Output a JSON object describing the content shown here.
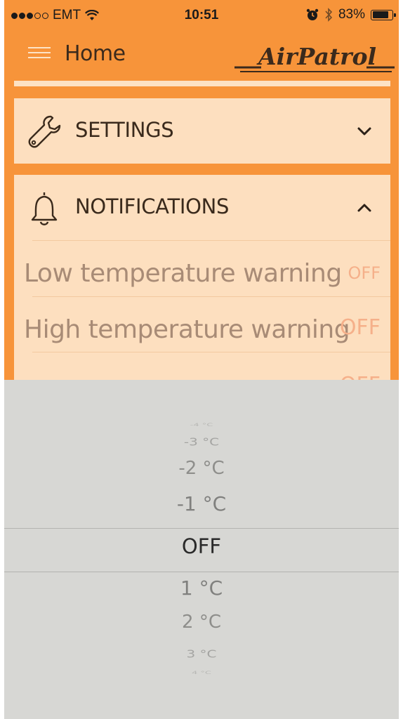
{
  "status_bar": {
    "carrier": "EMT",
    "time": "10:51",
    "battery": "83%",
    "battery_level": 0.83,
    "signal_bars_filled": 3,
    "signal_bars_total": 5,
    "icons": [
      "wifi-icon",
      "alarm-icon",
      "bluetooth-icon",
      "battery-icon"
    ]
  },
  "nav": {
    "title": "Home",
    "brand": "AirPatrol",
    "menu_icon": "hamburger-icon"
  },
  "colors": {
    "brand_orange": "#f7943a",
    "card_background": "#fddfbf",
    "picker_background": "#d7d7d4"
  },
  "sections": {
    "settings": {
      "label": "SETTINGS",
      "icon": "wrench-icon",
      "expanded": false
    },
    "notifications": {
      "label": "NOTIFICATIONS",
      "icon": "bell-icon",
      "expanded": true,
      "rows": [
        {
          "label": "Low temperature warning",
          "value": "OFF"
        },
        {
          "label": "High temperature warning",
          "value": "OFF"
        }
      ],
      "partial_row_value": "OFF"
    }
  },
  "picker": {
    "selected": "OFF",
    "options": [
      "-4 °C",
      "-3 °C",
      "-2 °C",
      "-1 °C",
      "OFF",
      "1 °C",
      "2 °C",
      "3 °C",
      "4 °C"
    ]
  }
}
